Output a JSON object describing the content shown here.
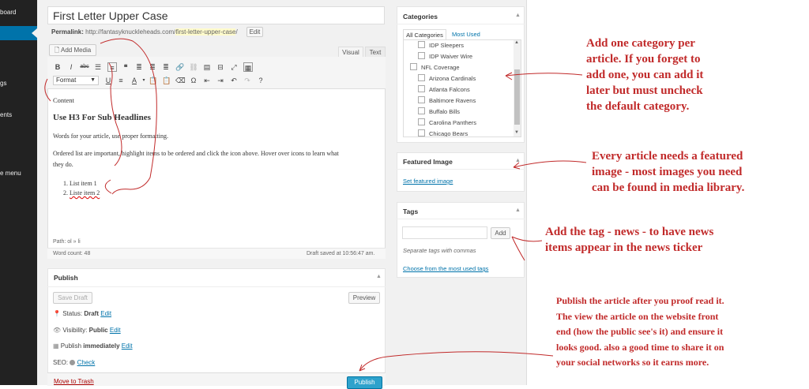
{
  "sidebar": {
    "items": [
      "board",
      "gs",
      "ents",
      "e menu"
    ]
  },
  "editor": {
    "title": "First Letter Upper Case",
    "permalink_label": "Permalink:",
    "permalink_base": "http://fantasyknuckleheads.com/",
    "permalink_slug": "first-letter-upper-case",
    "permalink_tail": "/",
    "edit_button": "Edit",
    "add_media": "Add Media",
    "tab_visual": "Visual",
    "tab_text": "Text",
    "format_select": "Format",
    "content": {
      "p1": "Content",
      "h3": "Use H3 For Sub Headlines",
      "p2": "Words for your article, use proper formatting.",
      "p3a": "Ordered list are important, highlight items to be ordered and click the icon above. Hover over icons to learn what",
      "p3b": "they do.",
      "li1": "List item 1",
      "li2": "Liste item 2"
    },
    "path": "Path: ol » li",
    "word_count": "Word count: 48",
    "draft_saved": "Draft saved at 10:56:47 am."
  },
  "publish": {
    "title": "Publish",
    "save_draft": "Save Draft",
    "preview": "Preview",
    "status_label": "Status:",
    "status_value": "Draft",
    "visibility_label": "Visibility:",
    "visibility_value": "Public",
    "publish_label": "Publish",
    "publish_value": "immediately",
    "seo_label": "SEO:",
    "seo_check": "Check",
    "edit": "Edit",
    "move_to_trash": "Move to Trash",
    "publish_button": "Publish"
  },
  "categories": {
    "title": "Categories",
    "tab_all": "All Categories",
    "tab_most_used": "Most Used",
    "items": [
      "IDP Sleepers",
      "IDP Waiver Wire",
      "NFL Coverage",
      "Arizona Cardinals",
      "Atlanta Falcons",
      "Baltimore Ravens",
      "Buffalo Bills",
      "Carolina Panthers",
      "Chicago Bears"
    ]
  },
  "featured": {
    "title": "Featured Image",
    "link": "Set featured image"
  },
  "tags": {
    "title": "Tags",
    "add": "Add",
    "hint": "Separate tags with commas",
    "choose": "Choose from the most used tags"
  },
  "annotations": {
    "categories": [
      "Add one category per",
      "article. If you forget to",
      "add one, you can add it",
      "later but must uncheck",
      "the default category."
    ],
    "featured": [
      "Every article needs a featured",
      "image - most images you need",
      "can be found in media library."
    ],
    "tags": [
      "Add the tag - news - to have news",
      "items appear in the news ticker"
    ],
    "publish": [
      "Publish the article after you proof read it.",
      "The view the article on the website front",
      "end (how the public see's it) and ensure it",
      "looks good. also a good time to share it on",
      "your social networks so it earns more."
    ]
  },
  "colors": {
    "accent": "#0073aa",
    "annotation": "#c12a2a",
    "sidebar": "#222222"
  }
}
